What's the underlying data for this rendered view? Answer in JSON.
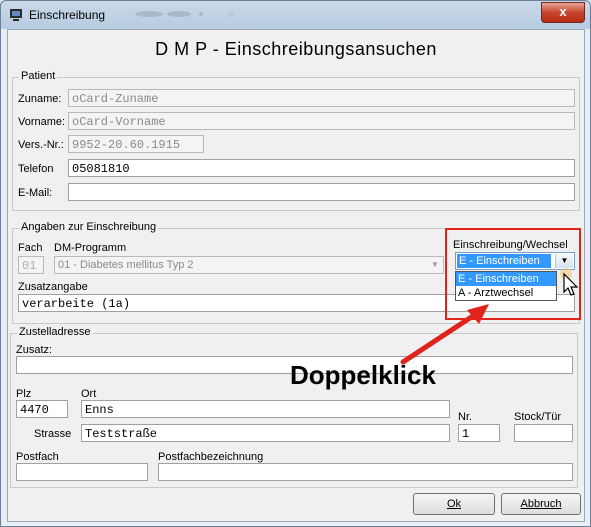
{
  "window": {
    "title": "Einschreibung",
    "close_label": "x"
  },
  "heading": "D M P - Einschreibungsansuchen",
  "patient": {
    "group_title": "Patient",
    "zuname_label": "Zuname:",
    "zuname_value": "oCard-Zuname",
    "vorname_label": "Vorname:",
    "vorname_value": "oCard-Vorname",
    "versnr_label": "Vers.-Nr.:",
    "versnr_value": "9952-20.60.1915",
    "telefon_label": "Telefon",
    "telefon_value": "05081810",
    "email_label": "E-Mail:",
    "email_value": ""
  },
  "einschreibung": {
    "group_title": "Angaben zur Einschreibung",
    "fach_label": "Fach",
    "fach_value": "01",
    "dm_label": "DM-Programm",
    "dm_value": "01 - Diabetes mellitus Typ 2",
    "wechsel_label": "Einschreibung/Wechsel",
    "wechsel_value": "E - Einschreiben",
    "wechsel_options": [
      "E - Einschreiben",
      "A - Arztwechsel"
    ],
    "zusatzangabe_label": "Zusatzangabe",
    "zusatzangabe_value": "verarbeite (1a)"
  },
  "zustell": {
    "group_title": "Zustelladresse",
    "zusatz_label": "Zusatz:",
    "zusatz_value": "",
    "plz_label": "Plz",
    "plz_value": "4470",
    "ort_label": "Ort",
    "ort_value": "Enns",
    "strasse_label": "Strasse",
    "strasse_value": "Teststraße",
    "nr_label": "Nr.",
    "nr_value": "1",
    "stock_label": "Stock/Tür",
    "stock_value": "",
    "postfach_label": "Postfach",
    "postfach_value": "",
    "postfachbez_label": "Postfachbezeichnung",
    "postfachbez_value": ""
  },
  "annotation": {
    "text": "Doppelklick",
    "color": "#e0241c"
  },
  "buttons": {
    "ok_label": "Ok",
    "abbruch_label": "Abbruch"
  }
}
